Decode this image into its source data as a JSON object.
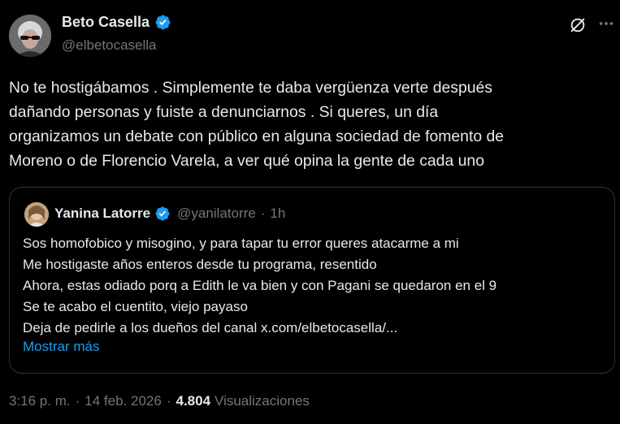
{
  "author": {
    "display_name": "Beto Casella",
    "handle": "@elbetocasella",
    "verified": true
  },
  "tweet": {
    "text": "No te hostigábamos . Simplemente te daba vergüenza verte después\ndañando personas y fuiste a denunciarnos . Si queres, un día\norganizamos un debate con público en alguna sociedad de fomento de\nMoreno o de Florencio Varela, a ver qué opina la gente de cada uno"
  },
  "quoted": {
    "display_name": "Yanina Latorre",
    "handle": "@yanilatorre",
    "separator": "·",
    "time": "1h",
    "verified": true,
    "text": "Sos homofobico y misogino, y para tapar tu error queres atacarme a mi\nMe hostigaste años enteros desde tu programa, resentido\nAhora, estas odiado porq a Edith le va bien y con Pagani se quedaron en el 9\nSe te acabo el cuentito, viejo payaso\nDeja de pedirle a los dueños del canal x.com/elbetocasella/...",
    "show_more": "Mostrar más"
  },
  "meta": {
    "time": "3:16 p. m.",
    "separator1": "·",
    "date": "14 feb. 2026",
    "separator2": "·",
    "views_count": "4.804",
    "views_label": "Visualizaciones"
  },
  "icons": {
    "verified": "verified-badge-icon",
    "grok": "grok-icon",
    "more": "more-options-icon"
  },
  "colors": {
    "background": "#000000",
    "text": "#e7e9ea",
    "secondary": "#71767b",
    "accent": "#1d9bf0",
    "border": "#2f3336"
  }
}
